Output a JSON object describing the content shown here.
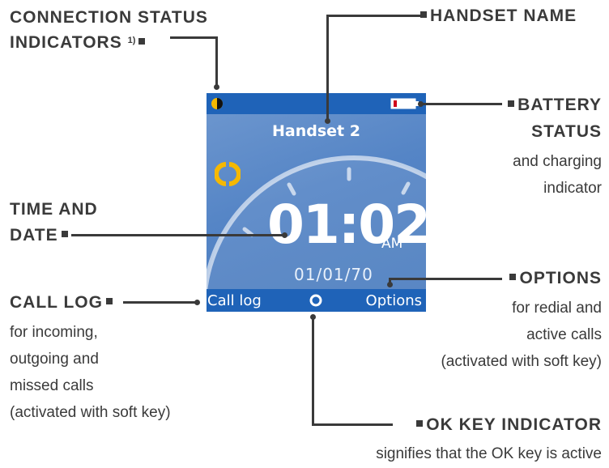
{
  "labels": {
    "connection_status_line1": "CONNECTION STATUS",
    "connection_status_line2": "INDICATORS",
    "connection_status_note": "1)",
    "handset_name": "HANDSET NAME",
    "battery_line1": "BATTERY",
    "battery_line2": "STATUS",
    "battery_desc_line1": "and charging",
    "battery_desc_line2": "indicator",
    "time_date_line1": "TIME AND",
    "time_date_line2": "DATE",
    "options": "OPTIONS",
    "options_desc_line1": "for redial and",
    "options_desc_line2": "active calls",
    "options_desc_line3": "(activated with soft key)",
    "call_log": "CALL LOG",
    "call_log_desc_line1": "for incoming,",
    "call_log_desc_line2": "outgoing and",
    "call_log_desc_line3": "missed calls",
    "call_log_desc_line4": "(activated with soft key)",
    "ok_key": "OK KEY INDICATOR",
    "ok_key_desc": "signifies that the OK key is active"
  },
  "screen": {
    "handset_name": "Handset 2",
    "time": "01:02",
    "ampm": "AM",
    "date": "01/01/70",
    "softkey_left": "Call log",
    "softkey_right": "Options"
  },
  "icons": [
    "connection-status-icon",
    "battery-icon",
    "ringer-icon",
    "ok-key-icon"
  ],
  "colors": {
    "screen_background": "#5585c6",
    "screen_bars": "#1f63b8",
    "connection_icon": "#f5b800",
    "battery_charge": "#d0021b",
    "annotation_text": "#3a3a3a"
  }
}
